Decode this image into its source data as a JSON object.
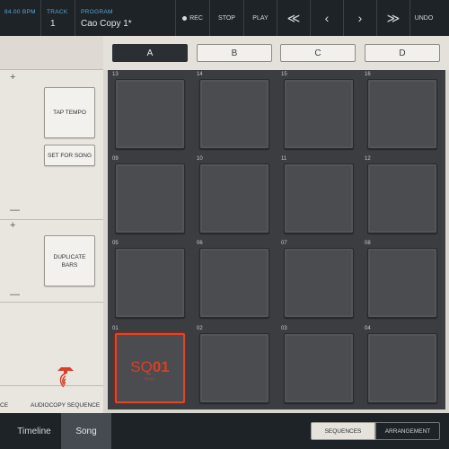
{
  "topbar": {
    "bpm": "84.00 BPM",
    "track_label": "TRACK",
    "track_value": "1",
    "program_label": "PROGRAM",
    "program_value": "Cao Copy 1*",
    "rec": "REC",
    "stop": "STOP",
    "play": "PLAY",
    "nav_first": "≪",
    "nav_prev": "‹",
    "nav_next": "›",
    "nav_last": "≫",
    "undo": "UNDO"
  },
  "left_panel": {
    "plus": "+",
    "minus": "—",
    "tap_tempo": "TAP TEMPO",
    "set_for_song": "SET FOR SONG",
    "duplicate_bars": "DUPLICATE BARS",
    "audiocopy_partial": "CE",
    "audiocopy_sequence": "AUDIOCOPY SEQUENCE"
  },
  "banks": [
    "A",
    "B",
    "C",
    "D"
  ],
  "active_bank": "A",
  "pads": [
    {
      "number": "13"
    },
    {
      "number": "14"
    },
    {
      "number": "15"
    },
    {
      "number": "16"
    },
    {
      "number": "09"
    },
    {
      "number": "10"
    },
    {
      "number": "11"
    },
    {
      "number": "12"
    },
    {
      "number": "05"
    },
    {
      "number": "06"
    },
    {
      "number": "07"
    },
    {
      "number": "08"
    },
    {
      "number": "01"
    },
    {
      "number": "02"
    },
    {
      "number": "03"
    },
    {
      "number": "04"
    }
  ],
  "selected_pad": {
    "seq_prefix": "SQ",
    "seq_number": "01",
    "sub_label": "SEQ01"
  },
  "bottombar": {
    "timeline": "Timeline",
    "song": "Song",
    "sequences": "SEQUENCES",
    "arrangement": "ARRANGEMENT"
  },
  "colors": {
    "accent_red": "#e0452a",
    "top_accent_blue": "#5aa6d6",
    "dark_bar": "#1e2328"
  }
}
